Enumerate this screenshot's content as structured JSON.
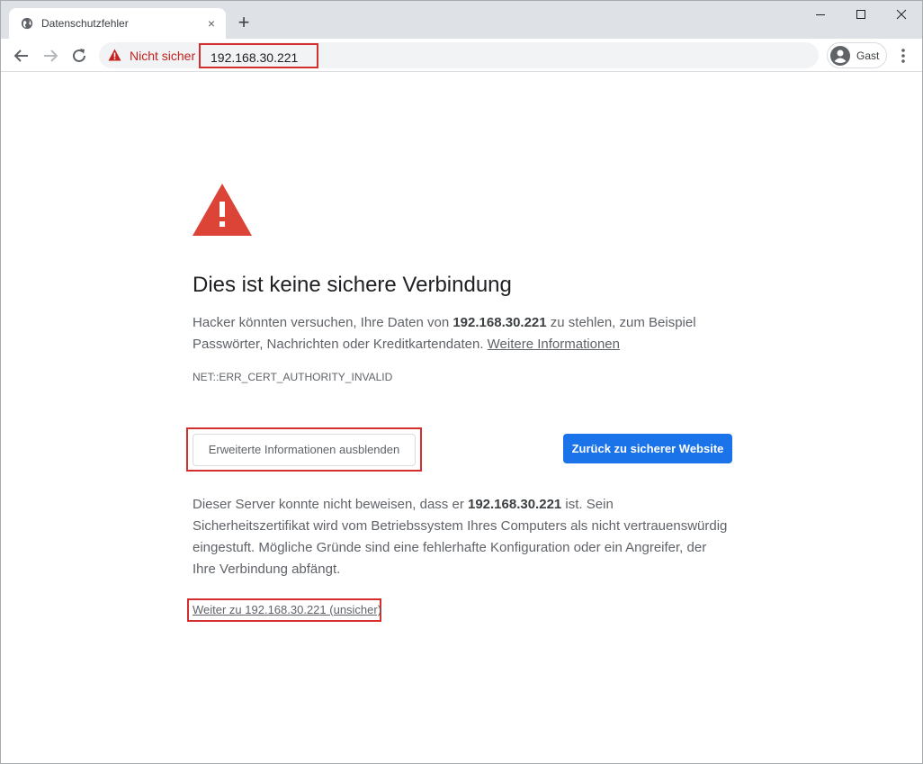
{
  "tab": {
    "title": "Datenschutzfehler",
    "close_symbol": "×",
    "favicon": "globe-icon"
  },
  "new_tab_symbol": "+",
  "window_controls": {
    "minimize": "minimize-icon",
    "maximize": "maximize-icon",
    "close": "close-icon"
  },
  "toolbar": {
    "security_label": "Nicht sicher",
    "url": "192.168.30.221",
    "profile_name": "Gast"
  },
  "page": {
    "heading": "Dies ist keine sichere Verbindung",
    "para1": {
      "before": "Hacker könnten versuchen, Ihre Daten von ",
      "host": "192.168.30.221",
      "after": " zu stehlen, zum Beispiel Passwörter, Nachrichten oder Kreditkartendaten. ",
      "link": "Weitere Informationen"
    },
    "error_code": "NET::ERR_CERT_AUTHORITY_INVALID",
    "advanced_button": "Erweiterte Informationen ausblenden",
    "back_button": "Zurück zu sicherer Website",
    "para2": {
      "before": "Dieser Server konnte nicht beweisen, dass er ",
      "host": "192.168.30.221",
      "after": " ist. Sein Sicherheitszertifikat wird vom Betriebssystem Ihres Computers als nicht vertrauenswürdig eingestuft. Mögliche Gründe sind eine fehlerhafte Konfiguration oder ein Angreifer, der Ihre Verbindung abfängt."
    },
    "proceed_link": "Weiter zu 192.168.30.221 (unsicher)"
  },
  "colors": {
    "warning_red": "#db4437",
    "highlight_red": "#d32f2f",
    "primary_blue": "#1a73e8",
    "not_secure_red": "#c5221f"
  }
}
